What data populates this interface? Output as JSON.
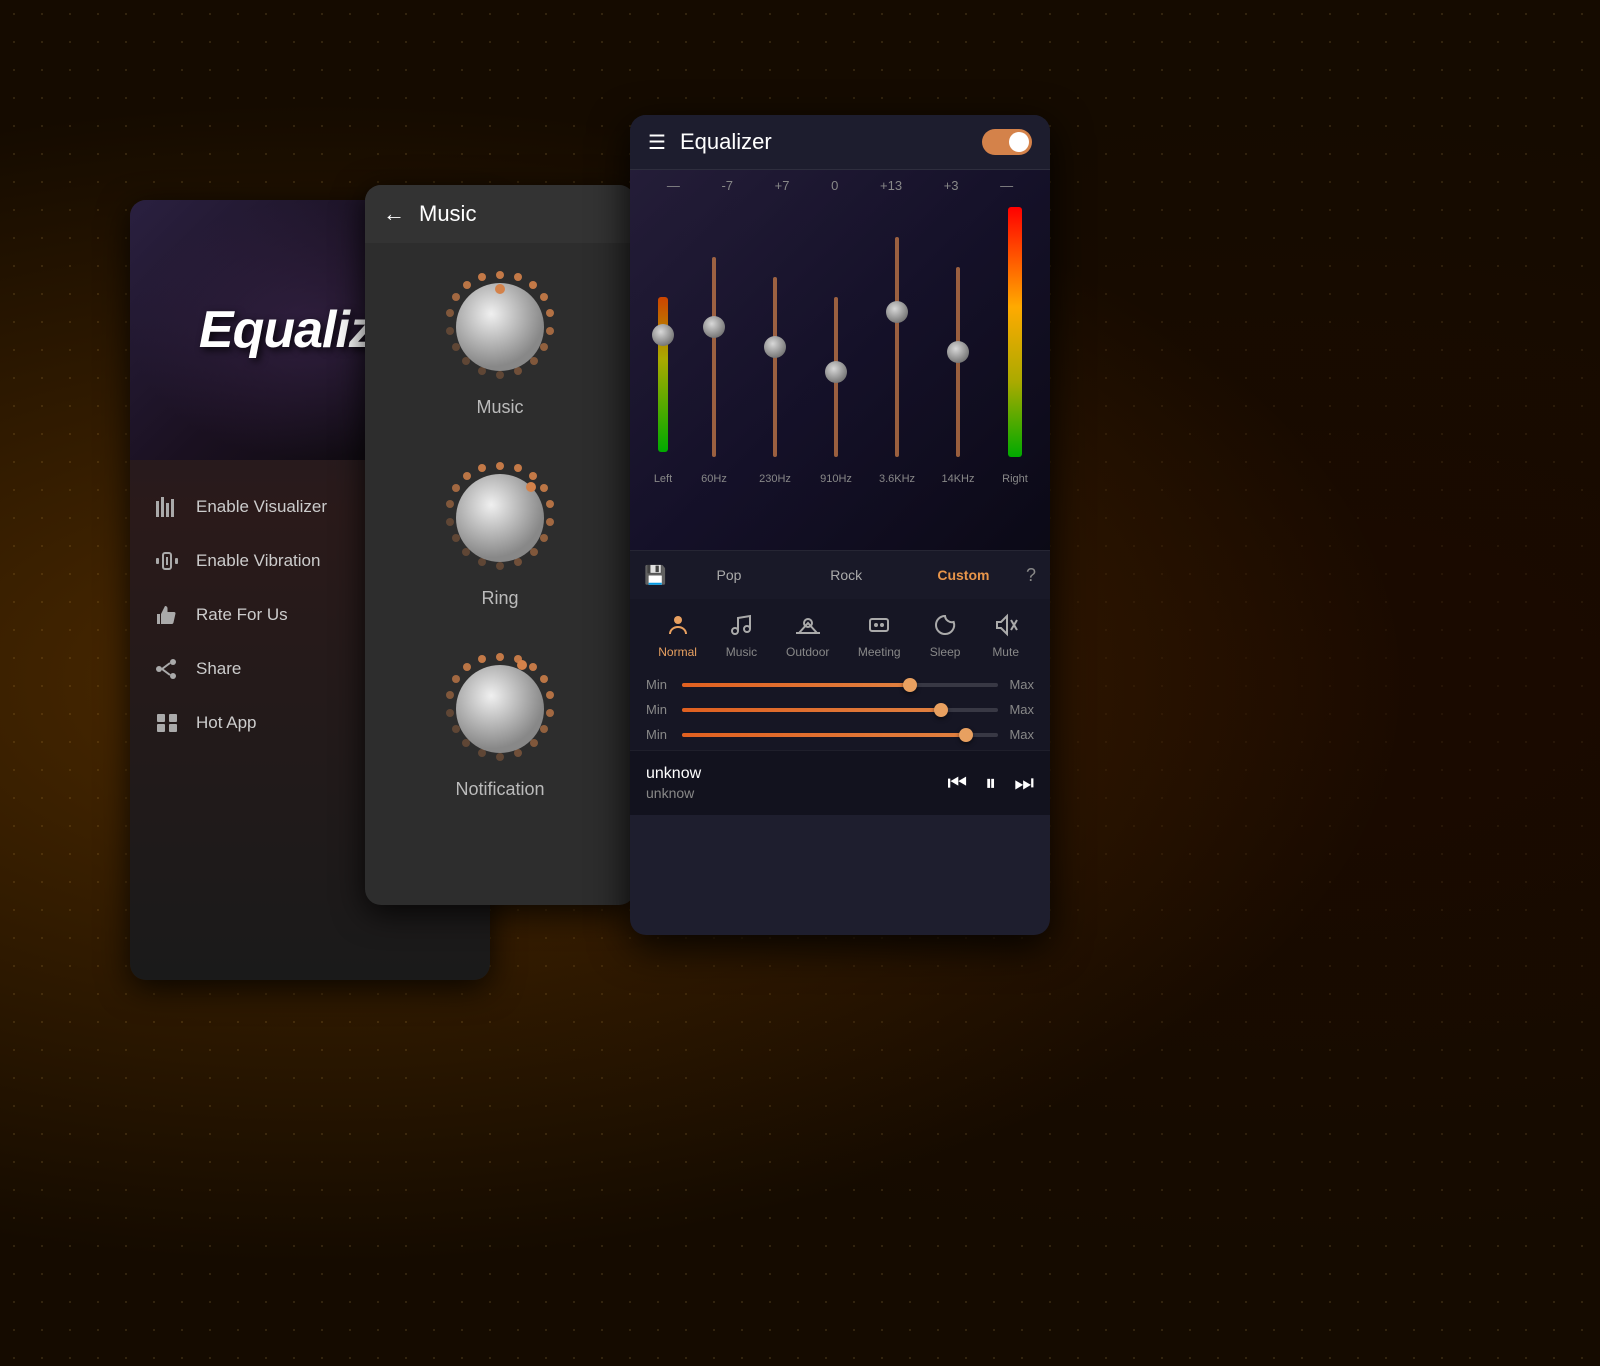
{
  "background": {
    "dot_color": "#c8a050"
  },
  "panel_left": {
    "header_title": "Equalizer",
    "menu_items": [
      {
        "id": "enable-visualizer",
        "icon": "bars-icon",
        "label": "Enable Visualizer",
        "has_toggle": true
      },
      {
        "id": "enable-vibration",
        "icon": "vibration-icon",
        "label": "Enable Vibration",
        "has_toggle": true
      },
      {
        "id": "rate-for-us",
        "icon": "thumbs-up-icon",
        "label": "Rate For Us",
        "has_toggle": false
      },
      {
        "id": "share",
        "icon": "share-icon",
        "label": "Share",
        "has_toggle": false
      },
      {
        "id": "hot-app",
        "icon": "hot-app-icon",
        "label": "Hot App",
        "has_toggle": false
      }
    ]
  },
  "panel_middle": {
    "title": "Music",
    "knobs": [
      {
        "id": "music-knob",
        "label": "Music",
        "dot_angle": 315
      },
      {
        "id": "ring-knob",
        "label": "Ring",
        "dot_angle": 45
      },
      {
        "id": "notification-knob",
        "label": "Notification",
        "dot_angle": 30
      }
    ]
  },
  "panel_right": {
    "header": {
      "title": "Equalizer",
      "toggle_on": true
    },
    "eq_chart": {
      "top_labels": [
        "-",
        "-7",
        "+7",
        "0",
        "+13",
        "+3",
        "-"
      ],
      "bars": [
        {
          "id": "left-bar",
          "label": "Left",
          "height_pct": 55,
          "handle_pct": 55,
          "color": "gradient"
        },
        {
          "id": "60hz-bar",
          "label": "60Hz",
          "height_pct": 70,
          "handle_pct": 70
        },
        {
          "id": "230hz-bar",
          "label": "230Hz",
          "height_pct": 50,
          "handle_pct": 50
        },
        {
          "id": "910hz-bar",
          "label": "910Hz",
          "height_pct": 40,
          "handle_pct": 40
        },
        {
          "id": "36khz-bar",
          "label": "3.6KHz",
          "height_pct": 80,
          "handle_pct": 80
        },
        {
          "id": "14khz-bar",
          "label": "14KHz",
          "height_pct": 60,
          "handle_pct": 60
        },
        {
          "id": "right-bar",
          "label": "Right",
          "height_pct": 95,
          "handle_pct": 0
        }
      ]
    },
    "presets": {
      "save_icon": "💾",
      "items": [
        {
          "id": "pop",
          "label": "Pop",
          "active": false
        },
        {
          "id": "rock",
          "label": "Rock",
          "active": false
        },
        {
          "id": "custom",
          "label": "Custom",
          "active": true
        }
      ],
      "help_icon": "?"
    },
    "modes": [
      {
        "id": "normal",
        "label": "Normal",
        "icon": "👤",
        "active": true
      },
      {
        "id": "music",
        "label": "Music",
        "icon": "🎵",
        "active": false
      },
      {
        "id": "outdoor",
        "label": "Outdoor",
        "icon": "🌅",
        "active": false
      },
      {
        "id": "meeting",
        "label": "Meeting",
        "icon": "👥",
        "active": false
      },
      {
        "id": "sleep",
        "label": "Sleep",
        "icon": "🌙",
        "active": false
      },
      {
        "id": "mute",
        "label": "Mute",
        "icon": "🔇",
        "active": false
      }
    ],
    "volume_sliders": [
      {
        "id": "slider1",
        "min": "Min",
        "max": "Max",
        "fill_pct": 72
      },
      {
        "id": "slider2",
        "min": "Min",
        "max": "Max",
        "fill_pct": 82
      },
      {
        "id": "slider3",
        "min": "Min",
        "max": "Max",
        "fill_pct": 90
      }
    ],
    "now_playing": {
      "title": "unknow",
      "artist": "unknow",
      "prev_icon": "⏮",
      "pause_icon": "⏸",
      "next_icon": "⏭"
    }
  }
}
